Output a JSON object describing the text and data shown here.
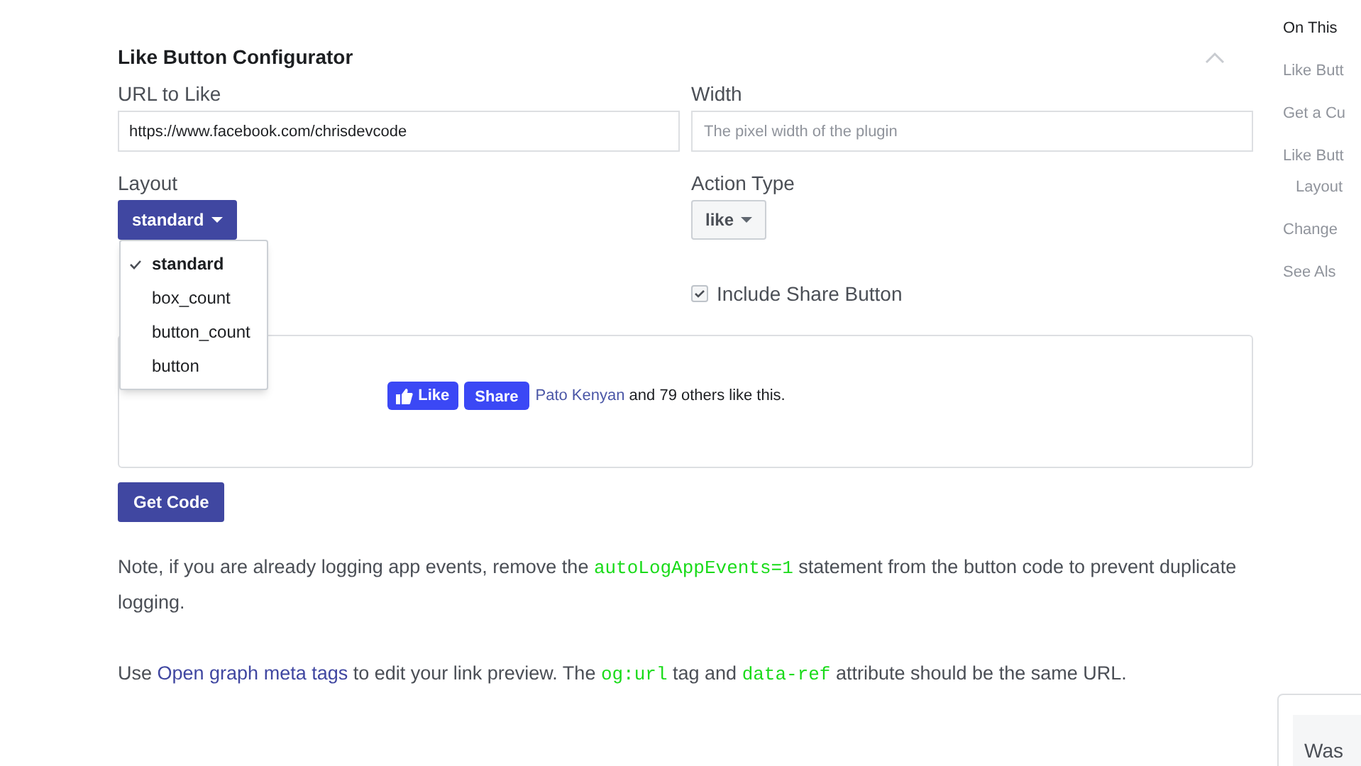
{
  "configurator": {
    "title": "Like Button Configurator",
    "url_field": {
      "label": "URL to Like",
      "value": "https://www.facebook.com/chrisdevcode"
    },
    "width_field": {
      "label": "Width",
      "placeholder": "The pixel width of the plugin"
    },
    "layout": {
      "label": "Layout",
      "value": "standard",
      "expanded": true,
      "options": [
        {
          "label": "standard",
          "selected": true
        },
        {
          "label": "box_count",
          "selected": false
        },
        {
          "label": "button_count",
          "selected": false
        },
        {
          "label": "button",
          "selected": false
        }
      ]
    },
    "action_type": {
      "label": "Action Type",
      "value": "like"
    },
    "share_option": {
      "label": "Include Share Button",
      "checked": true
    },
    "preview": {
      "like_label": "Like",
      "share_label": "Share",
      "friend": "Pato Kenyan",
      "social_text": "and 79 others like this."
    },
    "get_code": "Get Code"
  },
  "paragraphs": [
    [
      {
        "kind": "text",
        "text": "Note, if you are already logging app events, remove the "
      },
      {
        "kind": "code",
        "text": "autoLogAppEvents=1"
      },
      {
        "kind": "text",
        "text": " statement from the button code to prevent duplicate logging."
      }
    ],
    [
      {
        "kind": "text",
        "text": "Use "
      },
      {
        "kind": "link",
        "text": "Open graph meta tags"
      },
      {
        "kind": "text",
        "text": " to edit your link preview. The "
      },
      {
        "kind": "code",
        "text": "og:url"
      },
      {
        "kind": "text",
        "text": " tag and "
      },
      {
        "kind": "code",
        "text": "data-ref"
      },
      {
        "kind": "text",
        "text": " attribute should be the same URL."
      }
    ]
  ],
  "sidebar": {
    "title": "On This",
    "items": [
      {
        "label": "Like Butt"
      },
      {
        "label": "Get a Cu"
      },
      {
        "label": "Like Butt",
        "children": [
          {
            "label": "Layout"
          }
        ]
      },
      {
        "label": "Change"
      },
      {
        "label": "See Als"
      }
    ]
  },
  "feedback": {
    "title": "Was"
  }
}
